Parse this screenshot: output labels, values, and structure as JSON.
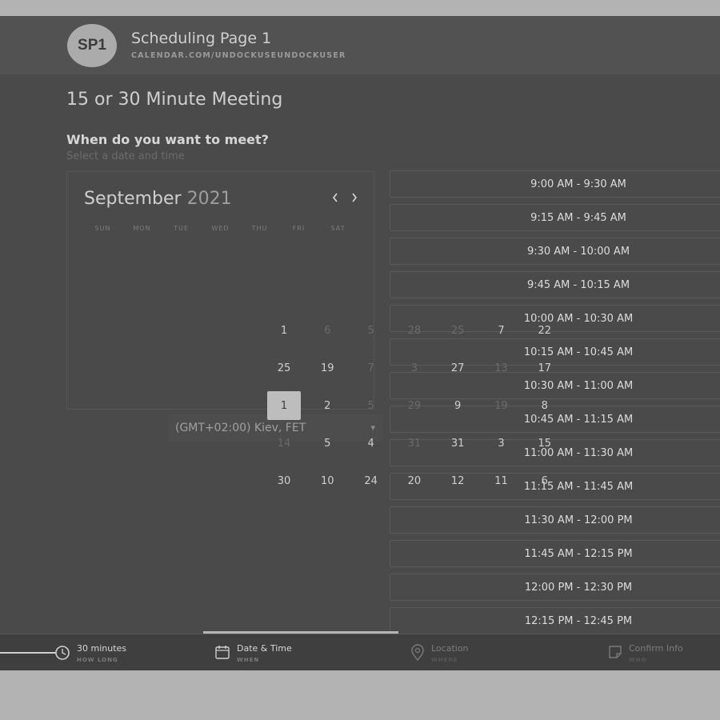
{
  "header": {
    "avatar_initials": "SP1",
    "page_name": "Scheduling Page 1",
    "page_url": "CALENDAR.COM/UNDOCKUSEUNDOCKUSER"
  },
  "meeting": {
    "title": "15 or 30 Minute Meeting",
    "question": "When do you want to meet?",
    "subtext": "Select a date and time"
  },
  "calendar": {
    "month": "September",
    "year": "2021",
    "prev_icon": "chevron-left-icon",
    "next_icon": "chevron-right-icon",
    "weekdays": [
      "SUN",
      "MON",
      "TUE",
      "WED",
      "THU",
      "FRI",
      "SAT"
    ],
    "days": [
      {
        "label": "1",
        "muted": false,
        "selected": false
      },
      {
        "label": "6",
        "muted": true,
        "selected": false
      },
      {
        "label": "5",
        "muted": true,
        "selected": false
      },
      {
        "label": "28",
        "muted": true,
        "selected": false
      },
      {
        "label": "25",
        "muted": true,
        "selected": false
      },
      {
        "label": "7",
        "muted": false,
        "selected": false
      },
      {
        "label": "22",
        "muted": false,
        "selected": false
      },
      {
        "label": "25",
        "muted": false,
        "selected": false
      },
      {
        "label": "19",
        "muted": false,
        "selected": false
      },
      {
        "label": "7",
        "muted": true,
        "selected": false
      },
      {
        "label": "3",
        "muted": true,
        "selected": false
      },
      {
        "label": "27",
        "muted": false,
        "selected": false
      },
      {
        "label": "13",
        "muted": true,
        "selected": false
      },
      {
        "label": "17",
        "muted": false,
        "selected": false
      },
      {
        "label": "1",
        "muted": false,
        "selected": true
      },
      {
        "label": "2",
        "muted": false,
        "selected": false
      },
      {
        "label": "5",
        "muted": true,
        "selected": false
      },
      {
        "label": "29",
        "muted": true,
        "selected": false
      },
      {
        "label": "9",
        "muted": false,
        "selected": false
      },
      {
        "label": "19",
        "muted": true,
        "selected": false
      },
      {
        "label": "8",
        "muted": false,
        "selected": false
      },
      {
        "label": "14",
        "muted": true,
        "selected": false
      },
      {
        "label": "5",
        "muted": false,
        "selected": false
      },
      {
        "label": "4",
        "muted": false,
        "selected": false
      },
      {
        "label": "31",
        "muted": true,
        "selected": false
      },
      {
        "label": "31",
        "muted": false,
        "selected": false
      },
      {
        "label": "3",
        "muted": false,
        "selected": false
      },
      {
        "label": "15",
        "muted": false,
        "selected": false
      },
      {
        "label": "30",
        "muted": false,
        "selected": false
      },
      {
        "label": "10",
        "muted": false,
        "selected": false
      },
      {
        "label": "24",
        "muted": false,
        "selected": false
      },
      {
        "label": "20",
        "muted": false,
        "selected": false
      },
      {
        "label": "12",
        "muted": false,
        "selected": false
      },
      {
        "label": "11",
        "muted": false,
        "selected": false
      },
      {
        "label": "6",
        "muted": false,
        "selected": false
      }
    ]
  },
  "timezone": {
    "value": "(GMT+02:00) Kiev, FET",
    "chevron_icon": "chevron-down-icon"
  },
  "time_slots": [
    "9:00 AM - 9:30 AM",
    "9:15 AM - 9:45 AM",
    "9:30 AM - 10:00 AM",
    "9:45 AM - 10:15 AM",
    "10:00 AM - 10:30 AM",
    "10:15 AM - 10:45 AM",
    "10:30 AM - 11:00 AM",
    "10:45 AM - 11:15 AM",
    "11:00 AM - 11:30 AM",
    "11:15 AM - 11:45 AM",
    "11:30 AM - 12:00 PM",
    "11:45 AM - 12:15 PM",
    "12:00 PM - 12:30 PM",
    "12:15 PM - 12:45 PM"
  ],
  "steps": [
    {
      "label": "30 minutes",
      "sub": "HOW LONG",
      "icon": "clock-icon",
      "active": false,
      "disabled": false
    },
    {
      "label": "Date & Time",
      "sub": "WHEN",
      "icon": "calendar-icon",
      "active": true,
      "disabled": false
    },
    {
      "label": "Location",
      "sub": "WHERE",
      "icon": "location-pin-icon",
      "active": false,
      "disabled": true
    },
    {
      "label": "Confirm Info",
      "sub": "WHO",
      "icon": "note-icon",
      "active": false,
      "disabled": true
    }
  ],
  "colors": {
    "overlay_bg": "#4a4a4a",
    "header_bg": "#525252",
    "selected_day_bg": "#bdbdbd",
    "outer_bg": "#b3b3b3"
  }
}
